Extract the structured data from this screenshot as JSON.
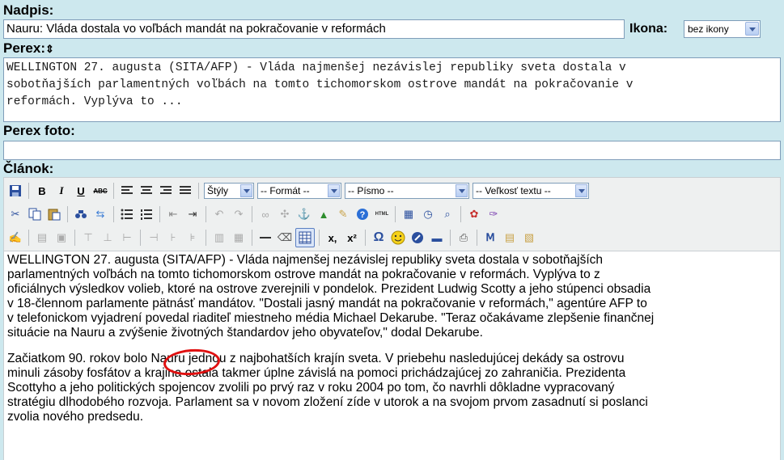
{
  "form": {
    "title_label": "Nadpis:",
    "title_value": "Nauru: Vláda dostala vo voľbách mandát na pokračovanie v reformách",
    "icon_label": "Ikona:",
    "icon_value": "bez ikony",
    "perex_label": "Perex:",
    "perex_sort_icon": "⇕",
    "perex_lines": [
      "WELLINGTON 27. augusta (SITA/AFP) - Vláda najmenšej nezávislej republiky sveta dostala v",
      "sobotňajších parlamentných voľbách na tomto tichomorskom ostrove mandát na pokračovanie v",
      "reformách. Vyplýva to ..."
    ],
    "perex_photo_label": "Perex foto:",
    "perex_photo_value": "",
    "article_label": "Článok:"
  },
  "toolbar": {
    "styles": "Štýly",
    "format": "-- Formát --",
    "font": "-- Písmo --",
    "font_size": "-- Veľkosť textu --",
    "bold": "B",
    "italic": "I",
    "underline": "U",
    "strike": "ABC",
    "html": "HTML",
    "subscript": "x,",
    "superscript": "x²",
    "omega": "Ω"
  },
  "editor": {
    "paragraph1_lines": [
      "WELLINGTON 27. augusta (SITA/AFP) - Vláda najmenšej nezávislej republiky sveta dostala v sobotňajších",
      "parlamentných voľbách na tomto tichomorskom ostrove mandát na pokračovanie v reformách. Vyplýva to z",
      "oficiálnych výsledkov volieb, ktoré na ostrove zverejnili v pondelok. Prezident Ludwig Scotty a jeho stúpenci obsadia",
      "v 18-člennom parlamente pätnásť mandátov. \"Dostali jasný mandát na pokračovanie v reformách,\" agentúre AFP to",
      "v telefonickom vyjadrení povedal riaditeľ miestneho média Michael Dekarube. \"Teraz očakávame zlepšenie finančnej",
      "situácie na Nauru a zvýšenie životných štandardov jeho obyvateľov,\" dodal Dekarube."
    ],
    "paragraph2_lines": [
      "Začiatkom 90. rokov bolo Nauru jednou z najbohatších krajín sveta. V priebehu nasledujúcej dekády sa ostrovu",
      "minuli zásoby fosfátov a krajina ostala takmer úplne závislá na pomoci prichádzajúcej zo zahraničia. Prezidenta",
      "Scottyho a jeho politických spojencov zvolili po prvý raz v roku 2004 po tom, čo navrhli dôkladne vypracovaný",
      "stratégiu dlhodobého rozvoja. Parlament sa v novom zložení zíde v utorok a na svojom prvom zasadnutí si poslanci",
      "zvolia nového predsedu."
    ]
  },
  "colors": {
    "background": "#cde8ee",
    "annotation_circle": "#e01010",
    "field_border": "#7f9db9"
  }
}
